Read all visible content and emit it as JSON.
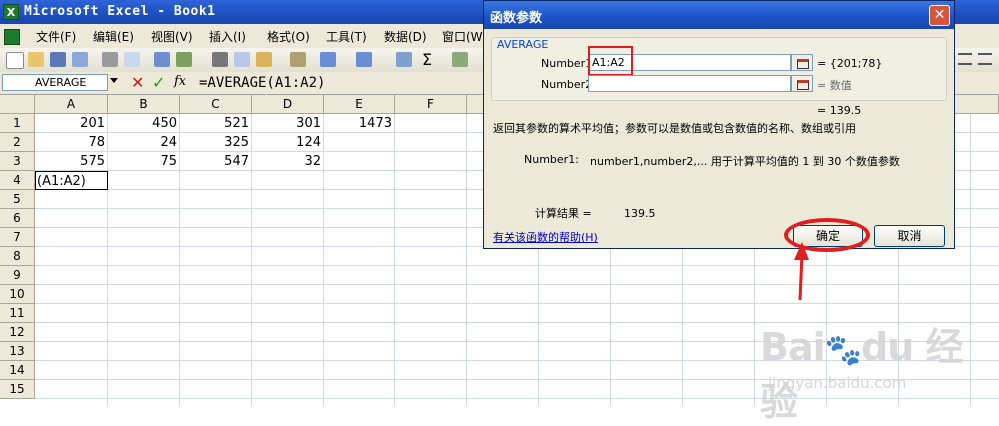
{
  "app": {
    "title": "Microsoft Excel - Book1",
    "icon": "excel-icon"
  },
  "menu": [
    "文件(F)",
    "编辑(E)",
    "视图(V)",
    "插入(I)",
    "格式(O)",
    "工具(T)",
    "数据(D)",
    "窗口(W)"
  ],
  "formula_bar": {
    "name_box": "AVERAGE",
    "cancel": "✕",
    "enter": "✓",
    "fx": "fx",
    "formula": "=AVERAGE(A1:A2)"
  },
  "columns": [
    "A",
    "B",
    "C",
    "D",
    "E",
    "F"
  ],
  "rows": [
    "1",
    "2",
    "3",
    "4",
    "5",
    "6",
    "7",
    "8",
    "9",
    "10",
    "11",
    "12",
    "13",
    "14",
    "15"
  ],
  "cells": {
    "r1": [
      "201",
      "450",
      "521",
      "301",
      "1473"
    ],
    "r2": [
      "78",
      "24",
      "325",
      "124"
    ],
    "r3": [
      "575",
      "75",
      "547",
      "32"
    ],
    "r4_a": "(A1:A2)"
  },
  "dialog": {
    "title": "函数参数",
    "close": "✕",
    "function_name": "AVERAGE",
    "number1_label": "Number1",
    "number1_value": "A1:A2",
    "number1_result": "= {201;78}",
    "number2_label": "Number2",
    "number2_result": "= 数值",
    "total_result": "= 139.5",
    "description": "返回其参数的算术平均值；参数可以是数值或包含数值的名称、数组或引用",
    "param_label": "Number1:",
    "param_desc": "number1,number2,... 用于计算平均值的 1 到 30 个数值参数",
    "calc_result_label": "计算结果 =",
    "calc_result_value": "139.5",
    "help_link": "有关该函数的帮助(H)",
    "ok": "确定",
    "cancel": "取消"
  },
  "annotation_colors": {
    "highlight": "#e21d1d",
    "arrow": "#e21d1d"
  },
  "watermark": {
    "brand": "Bai du 经验",
    "url": "jingyan.baidu.com"
  }
}
